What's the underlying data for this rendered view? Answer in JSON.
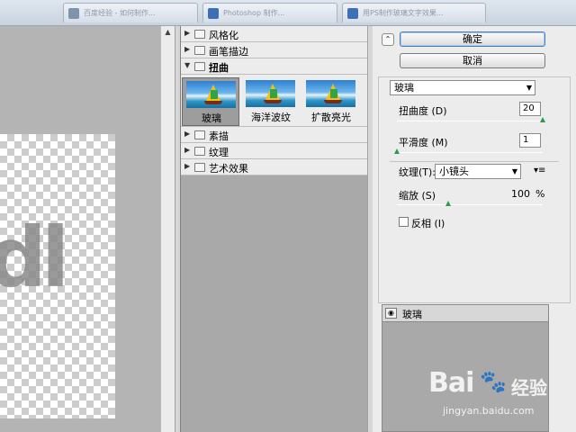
{
  "browser_tabs": [
    {
      "title": "百度经验 - 如何制作..."
    },
    {
      "title": "Photoshop 制作..."
    },
    {
      "title": "用PS制作玻璃文字效果..."
    }
  ],
  "preview": {
    "canvas_text": "dl"
  },
  "gallery": {
    "categories": [
      {
        "label": "风格化",
        "open": false
      },
      {
        "label": "画笔描边",
        "open": false
      },
      {
        "label": "扭曲",
        "open": true
      },
      {
        "label": "素描",
        "open": false
      },
      {
        "label": "纹理",
        "open": false
      },
      {
        "label": "艺术效果",
        "open": false
      }
    ],
    "distort_filters": [
      {
        "label": "玻璃",
        "selected": true
      },
      {
        "label": "海洋波纹",
        "selected": false
      },
      {
        "label": "扩散亮光",
        "selected": false
      }
    ]
  },
  "panel": {
    "ok_label": "确定",
    "cancel_label": "取消",
    "filter_select": "玻璃",
    "distortion_label": "扭曲度",
    "distortion_key": "(D)",
    "distortion_value": "20",
    "distortion_fraction": 1.0,
    "smoothness_label": "平滑度",
    "smoothness_key": "(M)",
    "smoothness_value": "1",
    "smoothness_fraction": 0.0,
    "texture_label": "纹理",
    "texture_key": "(T):",
    "texture_value": "小镜头",
    "scaling_label": "缩放",
    "scaling_key": "(S)",
    "scaling_value": "100",
    "scaling_unit": "%",
    "scaling_fraction": 0.35,
    "invert_label": "反相",
    "invert_key": "(I)",
    "invert_checked": false
  },
  "layers": {
    "items": [
      {
        "name": "玻璃",
        "visible": true
      }
    ]
  },
  "watermark": {
    "brand_a": "Bai",
    "brand_b": "经验",
    "url": "jingyan.baidu.com"
  }
}
